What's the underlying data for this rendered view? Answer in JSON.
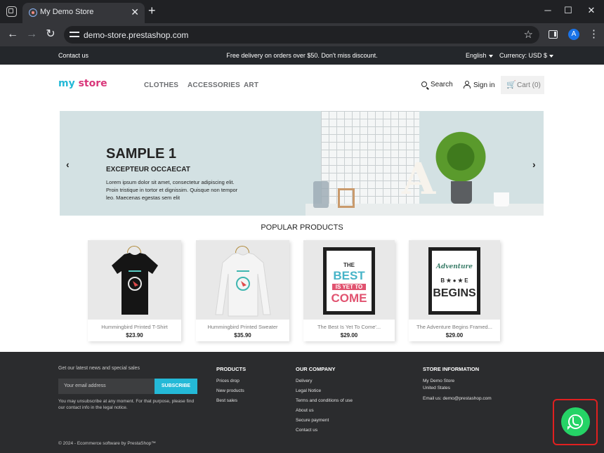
{
  "browser": {
    "tab_title": "My Demo Store",
    "tab_close": "✕",
    "new_tab": "+",
    "url": "demo-store.prestashop.com",
    "profile_initial": "A",
    "window_controls": {
      "minimize": "─",
      "maximize": "☐",
      "close": "✕"
    }
  },
  "topbar": {
    "contact": "Contact us",
    "promo": "Free delivery on orders over $50. Don't miss discount.",
    "language": "English",
    "currency": "Currency: USD $"
  },
  "header": {
    "logo_part1": "my",
    "logo_part2": "store",
    "nav": [
      "CLOTHES",
      "ACCESSORIES",
      "ART"
    ],
    "search": "Search",
    "signin": "Sign in",
    "cart": "Cart (0)"
  },
  "slider": {
    "title": "SAMPLE 1",
    "subtitle": "EXCEPTEUR OCCAECAT",
    "text": "Lorem ipsum dolor sit amet, consectetur adipiscing elit. Proin tristique in tortor et dignissim. Quisque non tempor leo. Maecenas egestas sem elit",
    "prev": "‹",
    "next": "›",
    "poster_letter": "A"
  },
  "products_section": {
    "title": "POPULAR PRODUCTS",
    "items": [
      {
        "name": "Hummingbird Printed T-Shirt",
        "price": "$23.90"
      },
      {
        "name": "Hummingbird Printed Sweater",
        "price": "$35.90"
      },
      {
        "name": "The Best Is Yet To Come'...",
        "price": "$29.00"
      },
      {
        "name": "The Adventure Begins Framed...",
        "price": "$29.00"
      }
    ],
    "poster_best": [
      "THE",
      "BEST",
      "IS YET TO",
      "COME"
    ],
    "poster_adventure": [
      "Adventure",
      "B ★ ● ★ E",
      "BEGINS"
    ]
  },
  "footer": {
    "newsletter_label": "Get our latest news and special sales",
    "email_placeholder": "Your email address",
    "subscribe": "SUBSCRIBE",
    "note": "You may unsubscribe at any moment. For that purpose, please find our contact info in the legal notice.",
    "products_title": "PRODUCTS",
    "products_links": [
      "Prices drop",
      "New products",
      "Best sales"
    ],
    "company_title": "OUR COMPANY",
    "company_links": [
      "Delivery",
      "Legal Notice",
      "Terms and conditions of use",
      "About us",
      "Secure payment",
      "Contact us"
    ],
    "store_title": "STORE INFORMATION",
    "store_name": "My Demo Store",
    "store_country": "United States",
    "store_email": "Email us: demo@prestashop.com",
    "copyright": "© 2024 - Ecommerce software by PrestaShop™"
  },
  "colors": {
    "accent": "#24b9d7",
    "logo_pink": "#d9367a",
    "whatsapp": "#25d366",
    "highlight": "#e02020"
  },
  "icons": [
    "tab-switcher-icon",
    "back-icon",
    "forward-icon",
    "reload-icon",
    "site-info-icon",
    "bookmark-star-icon",
    "side-panel-icon",
    "menu-icon",
    "search-icon",
    "user-icon",
    "cart-icon",
    "whatsapp-icon"
  ]
}
